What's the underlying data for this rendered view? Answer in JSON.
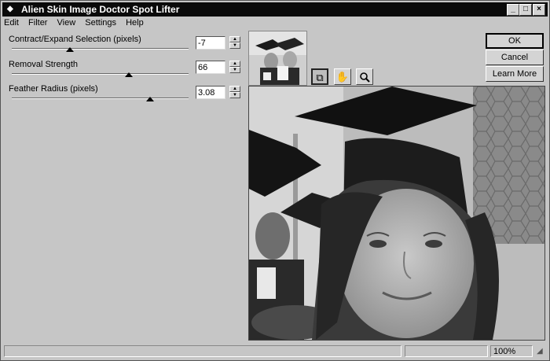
{
  "window": {
    "title": "Alien Skin Image Doctor Spot Lifter"
  },
  "menu": [
    "Edit",
    "Filter",
    "View",
    "Settings",
    "Help"
  ],
  "sliders": [
    {
      "label": "Contract/Expand Selection (pixels)",
      "value": "-7",
      "position": 0.33
    },
    {
      "label": "Removal Strength",
      "value": "66",
      "position": 0.66
    },
    {
      "label": "Feather Radius (pixels)",
      "value": "3.08",
      "position": 0.78
    }
  ],
  "buttons": {
    "ok": "OK",
    "cancel": "Cancel",
    "learn_more": "Learn More"
  },
  "tools": [
    "compare-tool",
    "hand-tool",
    "zoom-tool"
  ],
  "status": {
    "zoom": "100%"
  },
  "colors": {
    "titlebar": "#0a0a0a",
    "dialog": "#c6c6c6"
  }
}
